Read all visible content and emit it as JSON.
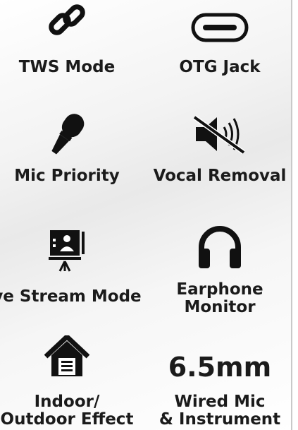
{
  "features": [
    {
      "icon": "link-icon",
      "label": "TWS Mode"
    },
    {
      "icon": "usb-c-port-icon",
      "label": "OTG Jack"
    },
    {
      "icon": "microphone-icon",
      "label": "Mic Priority"
    },
    {
      "icon": "speaker-muted-icon",
      "label": "Vocal Removal"
    },
    {
      "icon": "live-stream-screen-icon",
      "label": "ve Stream Mode"
    },
    {
      "icon": "headphones-icon",
      "label_lines": [
        "Earphone",
        "Monitor"
      ]
    },
    {
      "icon": "house-icon",
      "label_lines": [
        "Indoor/",
        "Outdoor Effect"
      ]
    },
    {
      "big_text": "6.5mm",
      "label_lines": [
        "Wired Mic",
        "& Instrument"
      ]
    }
  ]
}
